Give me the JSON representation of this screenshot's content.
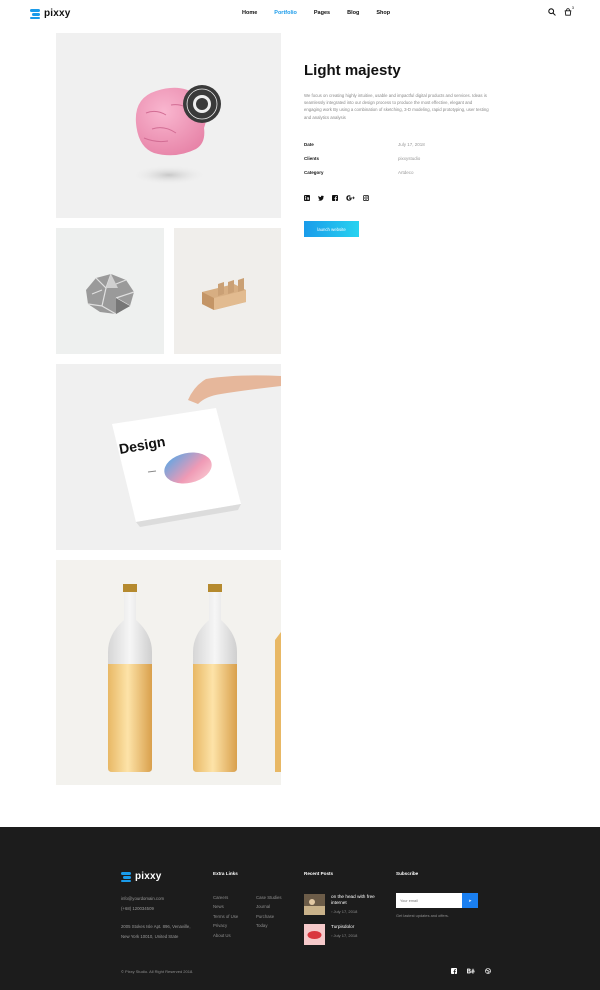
{
  "brand": {
    "name": "pixxy",
    "accent": "#1a9bea"
  },
  "nav": {
    "items": [
      {
        "label": "Home"
      },
      {
        "label": "Portfolio"
      },
      {
        "label": "Pages"
      },
      {
        "label": "Blog"
      },
      {
        "label": "Shop"
      }
    ],
    "active": "Portfolio",
    "cart_count": "3"
  },
  "project": {
    "title": "Light majesty",
    "description": "We focus on creating highly intuitive, usable and impactful digital products and services. Ideas is seamlessly integrated into our design process to produce the most effective, elegant and engaging work By using a combination of sketching, 3-D modeling, rapid prototyping, user testing and analytics analysis",
    "meta": [
      {
        "key": "Date",
        "value": "July 17, 2018"
      },
      {
        "key": "Clients",
        "value": "pixxystudio"
      },
      {
        "key": "Category",
        "value": "Artdeco"
      }
    ],
    "social_icons": [
      "linkedin-icon",
      "twitter-icon",
      "facebook-icon",
      "google-plus-icon",
      "instagram-icon"
    ],
    "launch_label": "launch website"
  },
  "gallery": {
    "images": [
      "ice-cream-scoop",
      "crumpled-paper",
      "wooden-stand",
      "design-poster-in-hand",
      "beer-bottles"
    ],
    "poster_text": "Design"
  },
  "footer": {
    "logo": "pixxy",
    "contact": {
      "email": "info@yourdomain.com",
      "phone": "(+68) 120034509",
      "address_line1": "2005 Stokes Isle Apt. 896, Venaville,",
      "address_line2": "New York 10010, United State"
    },
    "extra_links_title": "Extra Links",
    "extra_links_col1": [
      "Careers",
      "News",
      "Terms of Use",
      "Privacy",
      "About Us"
    ],
    "extra_links_col2": [
      "Case Studies",
      "Journal",
      "Purchase",
      "Today"
    ],
    "recent_posts_title": "Recent Posts",
    "recent_posts": [
      {
        "title": "on the head with free internet",
        "date": "July 17, 2018"
      },
      {
        "title": "Turpisdolor",
        "date": "July 17, 2018"
      }
    ],
    "subscribe_title": "Subscribe",
    "subscribe_placeholder": "Your email",
    "subscribe_note": "Get lastest updates and offers.",
    "copyright": "© Pixxy Studio. All Right Reserved 2018.",
    "social_icons": [
      "facebook-icon",
      "behance-icon",
      "dribbble-icon"
    ]
  }
}
